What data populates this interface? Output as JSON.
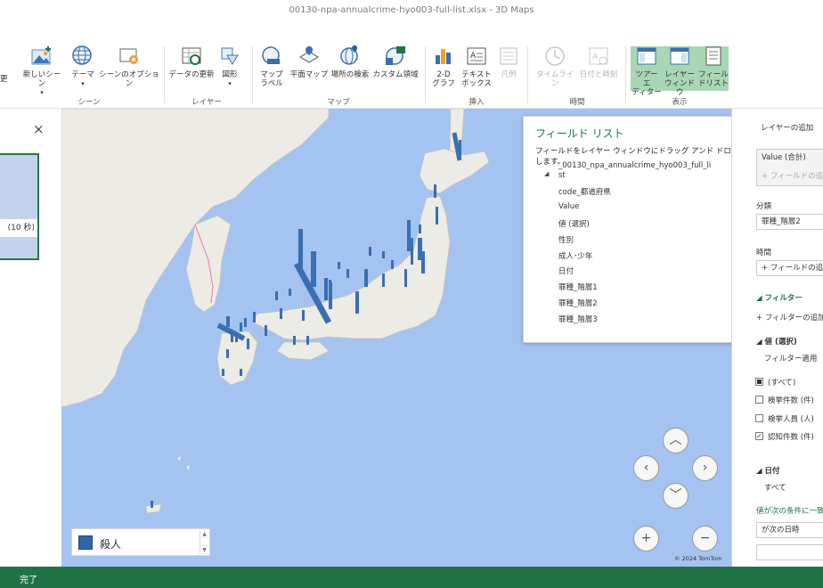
{
  "window": {
    "title": "00130-npa-annualcrime-hyo003-full-list.xlsx - 3D Maps"
  },
  "ribbon": {
    "buttons": {
      "new_scene": "新しいシーン",
      "theme": "テーマ",
      "scene_options": "シーンのオプション",
      "refresh_data": "データの更新",
      "shapes": "図形",
      "map_labels_1": "マップ",
      "map_labels_2": "ラベル",
      "flat_map": "平面マップ",
      "find_location": "場所の検索",
      "custom_region": "カスタム領域",
      "chart_2d_1": "2-D",
      "chart_2d_2": "グラフ",
      "textbox_1": "テキスト",
      "textbox_2": "ボックス",
      "legend": "凡例",
      "timeline": "タイムライン",
      "datetime": "日付と時刻",
      "tour_editor_1": "ツアー エ",
      "tour_editor_2": "ディター",
      "layer_pane_1": "レイヤー",
      "layer_pane_2": "ウィンドウ",
      "field_list_1": "フィール",
      "field_list_2": "ドリスト"
    },
    "groups": {
      "scene": "シーン",
      "layer": "レイヤー",
      "map": "マップ",
      "insert": "挿入",
      "time": "時間",
      "view": "表示"
    }
  },
  "left_panel": {
    "scene_duration": "(10 秒)",
    "close": "×"
  },
  "legend": {
    "label": "殺人",
    "swatch_color": "#2d65a6"
  },
  "map": {
    "copyright": "© 2024 TomTom",
    "water_color": "#a4c3f0",
    "land_color": "#ecebe6",
    "bar_color": "#3a6fb0"
  },
  "field_list": {
    "title": "フィールド リスト",
    "instructions": "フィールドをレイヤー ウィンドウにドラッグ アンド ドロップします。",
    "close": "×",
    "table_name_1": "_00130_npa_annualcrime_hyo003_full_li",
    "table_name_2": "st",
    "fields": [
      "code_都道府県",
      "Value",
      "値 (選択)",
      "性別",
      "成人･少年",
      "日付",
      "罪種_階層1",
      "罪種_階層2",
      "罪種_階層3"
    ]
  },
  "layer_pane": {
    "add_layer": "レイヤーの追加",
    "value_sum": "Value (合計)",
    "add_field_ghost": "フィールドの追加",
    "category_label": "分類",
    "category_value": "罪種_階層2",
    "time_label": "時間",
    "add_field": "フィールドの追加",
    "filter_header": "フィルター",
    "add_filter": "フィルターの追加",
    "value_select_header": "値 (選択)",
    "filter_apply": "フィルター適用",
    "options": [
      {
        "label": "(すべて)",
        "state": "partial"
      },
      {
        "label": "検挙件数 (件)",
        "state": "unchecked"
      },
      {
        "label": "検挙人員 (人)",
        "state": "unchecked"
      },
      {
        "label": "認知件数 (件)",
        "state": "checked"
      }
    ],
    "date_header": "日付",
    "date_value": "すべて",
    "condition_text": "値が次の条件に一致",
    "condition_select": "が次の日時"
  },
  "status": {
    "text": "完了"
  },
  "nav": {
    "zoom_in": "+",
    "zoom_out": "−"
  }
}
